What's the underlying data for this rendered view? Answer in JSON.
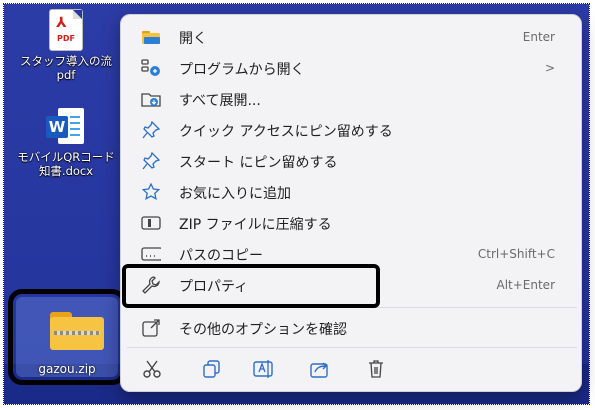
{
  "desktop": {
    "pdf_icon": {
      "badge": "PDF",
      "label_line1": "スタッフ導入の流",
      "label_line2": "pdf"
    },
    "word_icon": {
      "badge": "W",
      "label_line1": "モバイルQRコード",
      "label_line2": "知書.docx"
    },
    "zip_icon": {
      "label": "gazou.zip"
    }
  },
  "context_menu": {
    "items": [
      {
        "label": "開く",
        "shortcut": "Enter",
        "icon": "folder-open-icon"
      },
      {
        "label": "プログラムから開く",
        "shortcut": ">",
        "icon": "open-with-icon"
      },
      {
        "label": "すべて展開...",
        "shortcut": "",
        "icon": "extract-icon"
      },
      {
        "label": "クイック アクセスにピン留めする",
        "shortcut": "",
        "icon": "pin-icon"
      },
      {
        "label": "スタート にピン留めする",
        "shortcut": "",
        "icon": "pin-start-icon"
      },
      {
        "label": "お気に入りに追加",
        "shortcut": "",
        "icon": "star-icon"
      },
      {
        "label": "ZIP ファイルに圧縮する",
        "shortcut": "",
        "icon": "zip-icon"
      },
      {
        "label": "パスのコピー",
        "shortcut": "Ctrl+Shift+C",
        "icon": "copy-path-icon"
      },
      {
        "label": "プロパティ",
        "shortcut": "Alt+Enter",
        "icon": "wrench-icon"
      },
      {
        "label": "その他のオプションを確認",
        "shortcut": "",
        "icon": "more-options-icon"
      }
    ],
    "toolbar": [
      "cut-icon",
      "copy-icon",
      "rename-icon",
      "share-icon",
      "delete-icon"
    ]
  }
}
